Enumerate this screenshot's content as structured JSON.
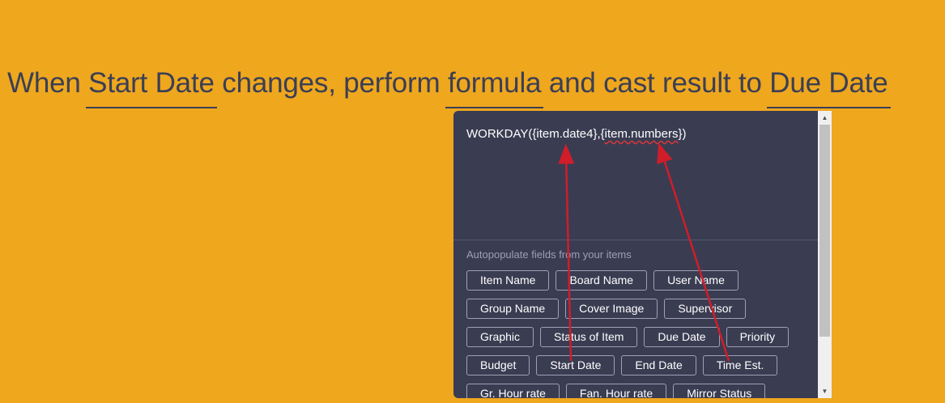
{
  "sentence": {
    "w1": "When",
    "trigger": "Start Date",
    "w2": "changes, perform",
    "action": "formula",
    "w3": "and cast result to",
    "target": "Due Date"
  },
  "formula": {
    "prefix": "WORKDAY({item.date4},{",
    "squiggle": "item.numbers",
    "suffix": "})"
  },
  "autopopulate_hint": "Autopopulate fields from your items",
  "field_rows": [
    [
      "Item Name",
      "Board Name",
      "User Name"
    ],
    [
      "Group Name",
      "Cover Image",
      "Supervisor"
    ],
    [
      "Graphic",
      "Status of Item",
      "Due Date",
      "Priority"
    ],
    [
      "Budget",
      "Start Date",
      "End Date",
      "Time Est."
    ],
    [
      "Gr. Hour rate",
      "Fan. Hour rate",
      "Mirror Status"
    ]
  ],
  "colors": {
    "background": "#efa71e",
    "panel": "#3a3c52",
    "text_dark": "#3a3f54",
    "annotation_arrow": "#d01d2a"
  },
  "icons": {
    "scroll_up": "▲",
    "scroll_down": "▼"
  }
}
